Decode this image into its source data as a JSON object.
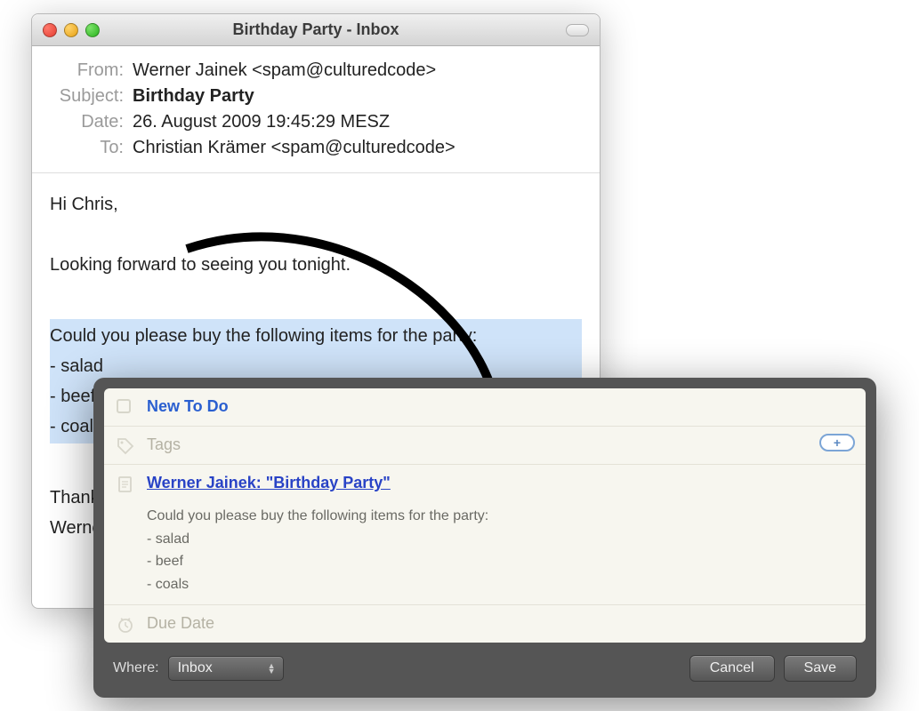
{
  "email": {
    "windowTitle": "Birthday Party - Inbox",
    "headers": {
      "fromLabel": "From:",
      "fromValue": "Werner Jainek <spam@culturedcode>",
      "subjectLabel": "Subject:",
      "subjectValue": "Birthday Party",
      "dateLabel": "Date:",
      "dateValue": "26. August 2009 19:45:29 MESZ",
      "toLabel": "To:",
      "toValue": "Christian Krämer <spam@culturedcode>"
    },
    "body": {
      "greeting": "Hi Chris,",
      "line1": "Looking forward to seeing you tonight.",
      "highlightLine": "Could you please buy the following items for the party:",
      "item1": "- salad",
      "item2": "- beef",
      "item3": "- coals",
      "closing1": "Thanks,",
      "closing2": "Werner"
    }
  },
  "todo": {
    "newTodo": "New To Do",
    "tagsPlaceholder": "Tags",
    "noteLink": "Werner Jainek: \"Birthday Party\"",
    "noteBody": "Could you please buy the following items for the party:",
    "noteItem1": "- salad",
    "noteItem2": "- beef",
    "noteItem3": "- coals",
    "dueDatePlaceholder": "Due Date",
    "whereLabel": "Where:",
    "whereValue": "Inbox",
    "cancelLabel": "Cancel",
    "saveLabel": "Save",
    "addPillLabel": "+"
  }
}
